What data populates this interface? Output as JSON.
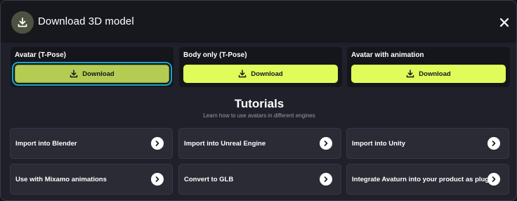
{
  "header": {
    "title": "Download 3D model"
  },
  "downloads": [
    {
      "label": "Avatar (T-Pose)",
      "button": "Download"
    },
    {
      "label": "Body only (T-Pose)",
      "button": "Download"
    },
    {
      "label": "Avatar with animation",
      "button": "Download"
    }
  ],
  "tutorials": {
    "title": "Tutorials",
    "subtitle": "Learn how to use avatars in different engines",
    "items": [
      "Import into Blender",
      "Import into Unreal Engine",
      "Import into Unity",
      "Use with Mixamo animations",
      "Convert to GLB",
      "Integrate Avaturn into your product as plugin"
    ]
  },
  "colors": {
    "accent": "#e0fc5a",
    "accent_selected": "#b4cc52",
    "focus_ring": "#1aa3c8",
    "background": "#1f2029"
  },
  "icons": [
    "download-icon",
    "close-icon",
    "arrow-right-icon"
  ]
}
